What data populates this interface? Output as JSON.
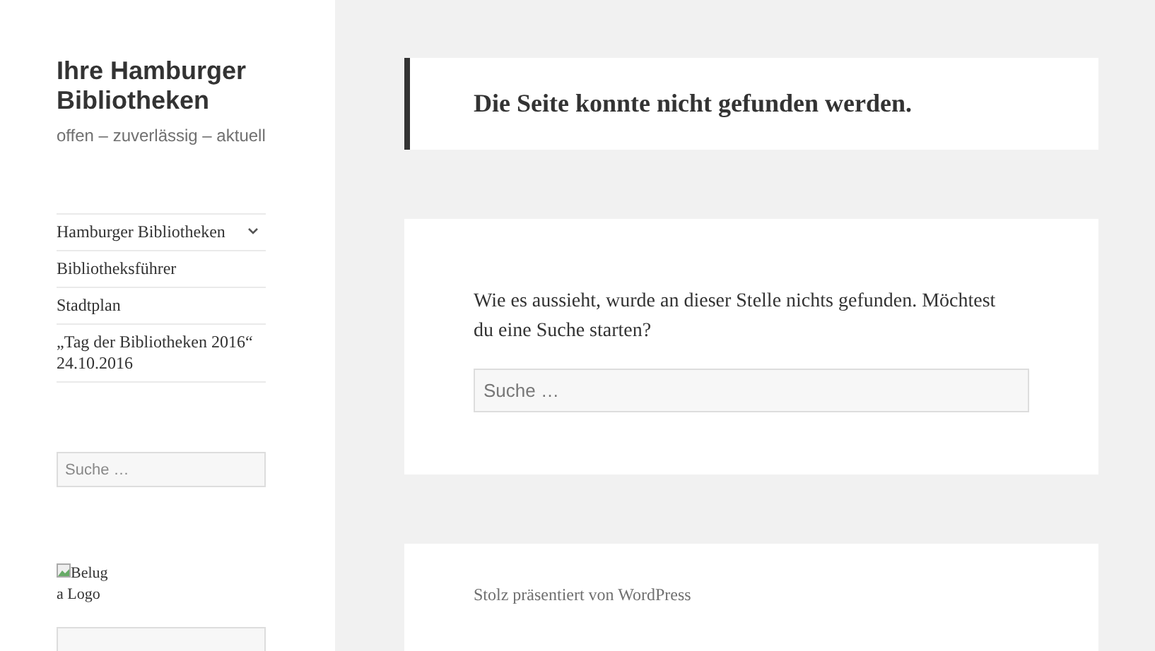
{
  "site": {
    "title": "Ihre Hamburger Bibliotheken",
    "tagline": "offen – zuverlässig – aktuell"
  },
  "menu": [
    {
      "label": "Hamburger Bibliotheken",
      "has_submenu": true
    },
    {
      "label": "Bibliotheksführer",
      "has_submenu": false
    },
    {
      "label": "Stadtplan",
      "has_submenu": false
    },
    {
      "label": "„Tag der Bibliotheken 2016“ 24.10.2016",
      "has_submenu": false
    }
  ],
  "sidebar_search": {
    "placeholder": "Suche …"
  },
  "logo": {
    "alt": "Beluga Logo"
  },
  "page": {
    "title": "Die Seite konnte nicht gefunden werden.",
    "message": "Wie es aussieht, wurde an dieser Stelle nichts gefunden. Möchtest du eine Suche starten?",
    "search": {
      "placeholder": "Suche …"
    }
  },
  "footer": {
    "credit": "Stolz präsentiert von WordPress"
  }
}
